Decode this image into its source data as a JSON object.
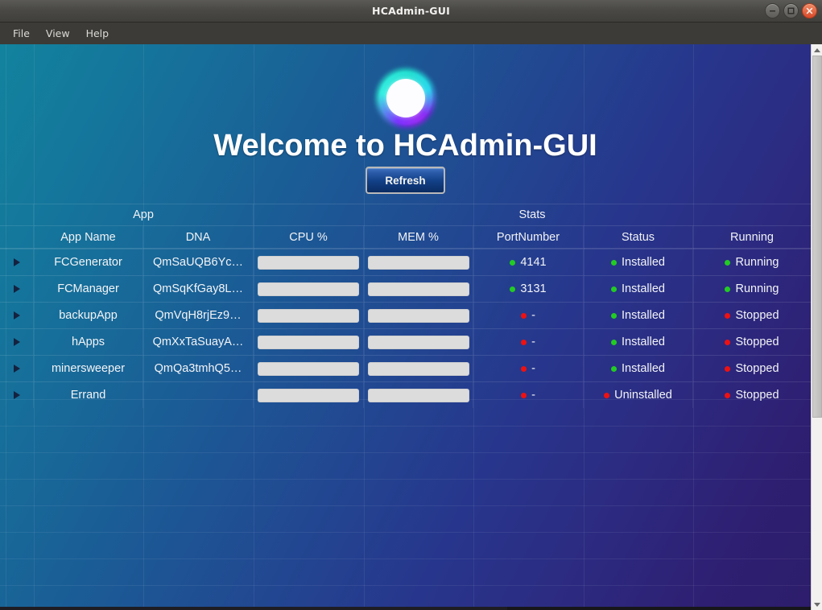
{
  "window": {
    "title": "HCAdmin-GUI",
    "controls": [
      {
        "name": "minimize",
        "glyph": "–"
      },
      {
        "name": "maximize",
        "glyph": "□"
      },
      {
        "name": "close",
        "glyph": "×"
      }
    ]
  },
  "menubar": {
    "items": [
      "File",
      "View",
      "Help"
    ]
  },
  "header": {
    "logo_name": "holochain-logo",
    "welcome_title": "Welcome to HCAdmin-GUI",
    "refresh_label": "Refresh"
  },
  "table": {
    "group_headers": [
      {
        "label": "",
        "key": "expander"
      },
      {
        "label": "App",
        "key": "app"
      },
      {
        "label": "Stats",
        "key": "stats"
      }
    ],
    "columns": [
      "App Name",
      "DNA",
      "CPU %",
      "MEM %",
      "PortNumber",
      "Status",
      "Running"
    ],
    "rows": [
      {
        "expander": "▶",
        "app_name": "FCGenerator",
        "dna": "QmSaUQB6Yc…",
        "cpu": "",
        "mem": "",
        "port": "4141",
        "port_state": "ok",
        "status": "Installed",
        "status_state": "ok",
        "running": "Running",
        "running_state": "ok"
      },
      {
        "expander": "▶",
        "app_name": "FCManager",
        "dna": "QmSqKfGay8L…",
        "cpu": "",
        "mem": "",
        "port": "3131",
        "port_state": "ok",
        "status": "Installed",
        "status_state": "ok",
        "running": "Running",
        "running_state": "ok"
      },
      {
        "expander": "▶",
        "app_name": "backupApp",
        "dna": "QmVqH8rjEz9…",
        "cpu": "",
        "mem": "",
        "port": "-",
        "port_state": "bad",
        "status": "Installed",
        "status_state": "ok",
        "running": "Stopped",
        "running_state": "bad"
      },
      {
        "expander": "▶",
        "app_name": "hApps",
        "dna": "QmXxTaSuayA…",
        "cpu": "",
        "mem": "",
        "port": "-",
        "port_state": "bad",
        "status": "Installed",
        "status_state": "ok",
        "running": "Stopped",
        "running_state": "bad"
      },
      {
        "expander": "▶",
        "app_name": "minersweeper",
        "dna": "QmQa3tmhQ5…",
        "cpu": "",
        "mem": "",
        "port": "-",
        "port_state": "bad",
        "status": "Installed",
        "status_state": "ok",
        "running": "Stopped",
        "running_state": "bad"
      },
      {
        "expander": "▶",
        "app_name": "Errand",
        "dna": "",
        "cpu": "",
        "mem": "",
        "port": "-",
        "port_state": "bad",
        "status": "Uninstalled",
        "status_state": "bad",
        "running": "Stopped",
        "running_state": "bad"
      }
    ]
  },
  "colors": {
    "status_ok": "#22cc22",
    "status_bad": "#ee1111",
    "accent_button": "#123f86",
    "bg_teal": "#12839e",
    "bg_purple": "#2d1d6b"
  },
  "scrollbars": {
    "vertical_name": "vertical-scrollbar",
    "horizontal_name": "horizontal-scrollbar"
  }
}
